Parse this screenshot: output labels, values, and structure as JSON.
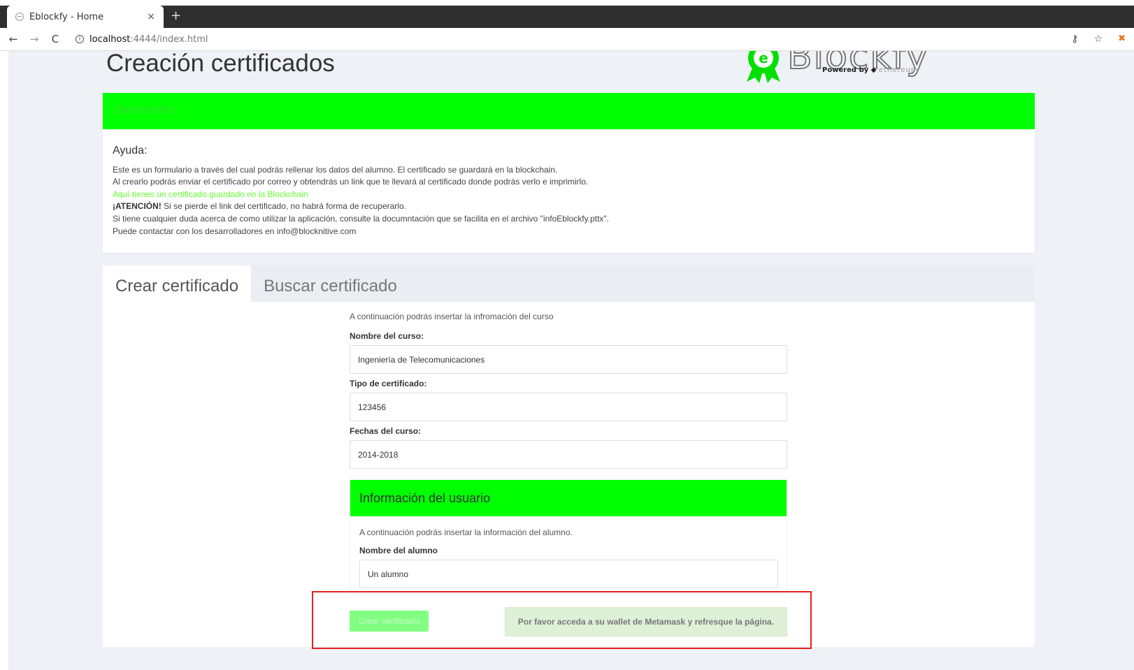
{
  "browser": {
    "tab_title": "Eblockfy - Home",
    "tab_close": "×",
    "new_tab": "+",
    "url_host": "localhost",
    "url_path": ":4444/index.html",
    "back": "←",
    "forward": "→",
    "reload": "C",
    "key_icon": "⚷",
    "star_icon": "☆",
    "ext_icon": "✖"
  },
  "header": {
    "title": "Creación certificados",
    "logo_word": "Blockfy",
    "logo_powered": "Powered by",
    "logo_eth": "ethereum"
  },
  "welcome": {
    "title": "¡Bienvenido!",
    "help_heading": "Ayuda:",
    "line1": "Este es un formulario a través del cual podrás rellenar los datos del alumno. El certificado se guardará en la blockchain.",
    "line2": "Al crearlo podrás enviar el certificado por correo y obtendrás un link que te llevará al certificado donde podrás verlo e imprimirlo.",
    "link": "Aquí tienes un certificado guardado en la Blockchain",
    "attention_label": "¡ATENCIÓN!",
    "attention_text": " Si se pierde el link del certificado, no habrá forma de recuperarlo.",
    "line4": "Si tiene cualquier duda acerca de como utilizar la aplicación, consulte la documntación que se facilita en el archivo \"infoEblockfy.pttx\".",
    "line5": "Puede contactar con los desarrolladores en info@blocknitive.com"
  },
  "tabs": [
    {
      "label": "Crear certificado",
      "active": true
    },
    {
      "label": "Buscar certificado",
      "active": false
    }
  ],
  "form": {
    "intro": "A continuación podrás insertar la infromación del curso",
    "course_label": "Nombre del curso:",
    "course_value": "Ingeniería de Telecomunicaciones",
    "type_label": "Tipo de certificado:",
    "type_value": "123456",
    "dates_label": "Fechas del curso:",
    "dates_value": "2014-2018",
    "user_panel_title": "Información del usuario",
    "user_intro": "A continuación podrás insertar la información del alumno.",
    "student_label": "Nombre del alumno",
    "student_value": "Un alumno",
    "submit_label": "Crear certificado",
    "alert": "Por favor acceda a su wallet de Metamask y refresque la página."
  },
  "colors": {
    "accent_green": "#00ff00",
    "highlight_red": "#e82020",
    "alert_bg": "#dff0d8"
  }
}
